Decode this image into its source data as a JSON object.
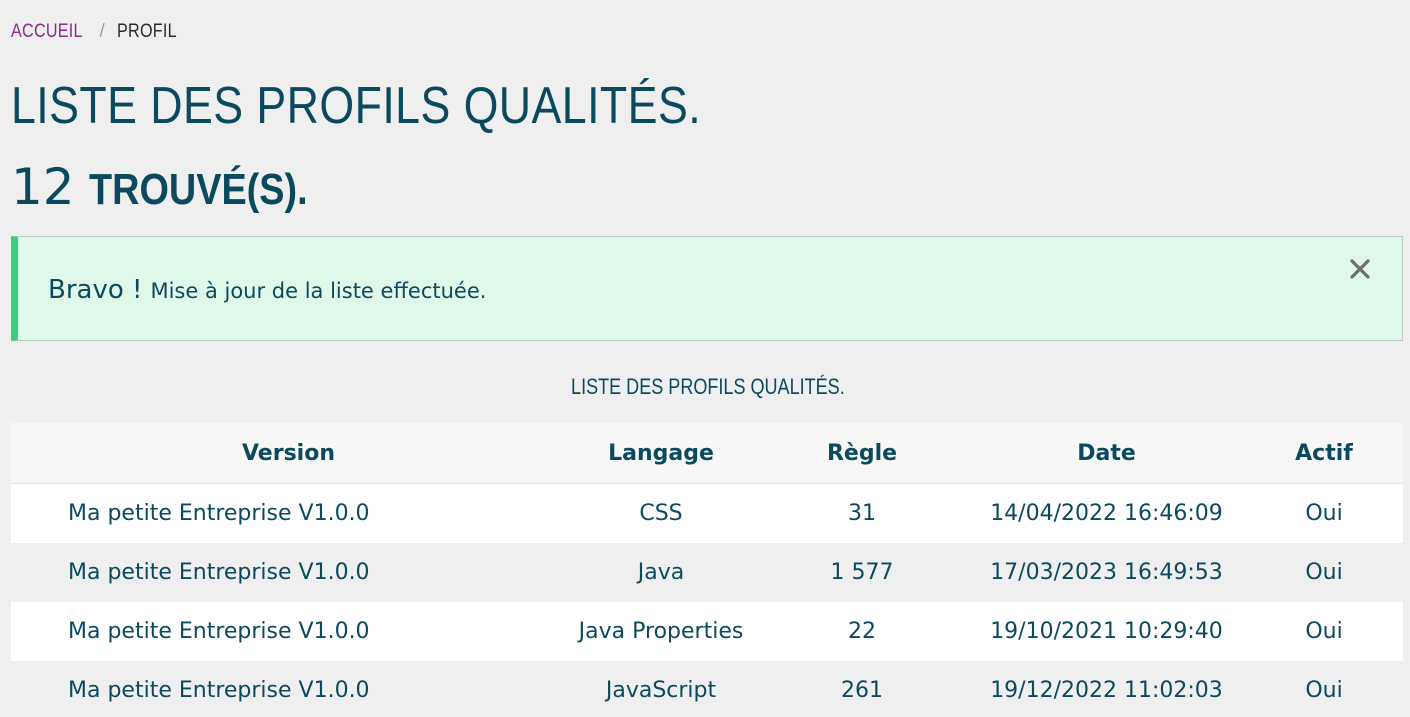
{
  "breadcrumb": {
    "home": "ACCUEIL",
    "separator": "/",
    "current": "PROFIL"
  },
  "title": "LISTE DES PROFILS QUALITÉS.",
  "count": {
    "number": "12",
    "label": "TROUVÉ(S)."
  },
  "alert": {
    "strong": "Bravo !",
    "message": "Mise à jour de la liste effectuée.",
    "close_icon": "close-icon",
    "accent_color": "#37d17a",
    "background_color": "#e0f8ea"
  },
  "table": {
    "caption": "LISTE DES PROFILS QUALITÉS.",
    "headers": [
      "Version",
      "Langage",
      "Règle",
      "Date",
      "Actif"
    ],
    "rows": [
      [
        "Ma petite Entreprise V1.0.0",
        "CSS",
        "31",
        "14/04/2022 16:46:09",
        "Oui"
      ],
      [
        "Ma petite Entreprise V1.0.0",
        "Java",
        "1 577",
        "17/03/2023 16:49:53",
        "Oui"
      ],
      [
        "Ma petite Entreprise V1.0.0",
        "Java Properties",
        "22",
        "19/10/2021 10:29:40",
        "Oui"
      ],
      [
        "Ma petite Entreprise V1.0.0",
        "JavaScript",
        "261",
        "19/12/2022 11:02:03",
        "Oui"
      ]
    ]
  },
  "colors": {
    "primary_text": "#0b4a5e",
    "link": "#8a2c86",
    "page_background": "#efefef"
  }
}
